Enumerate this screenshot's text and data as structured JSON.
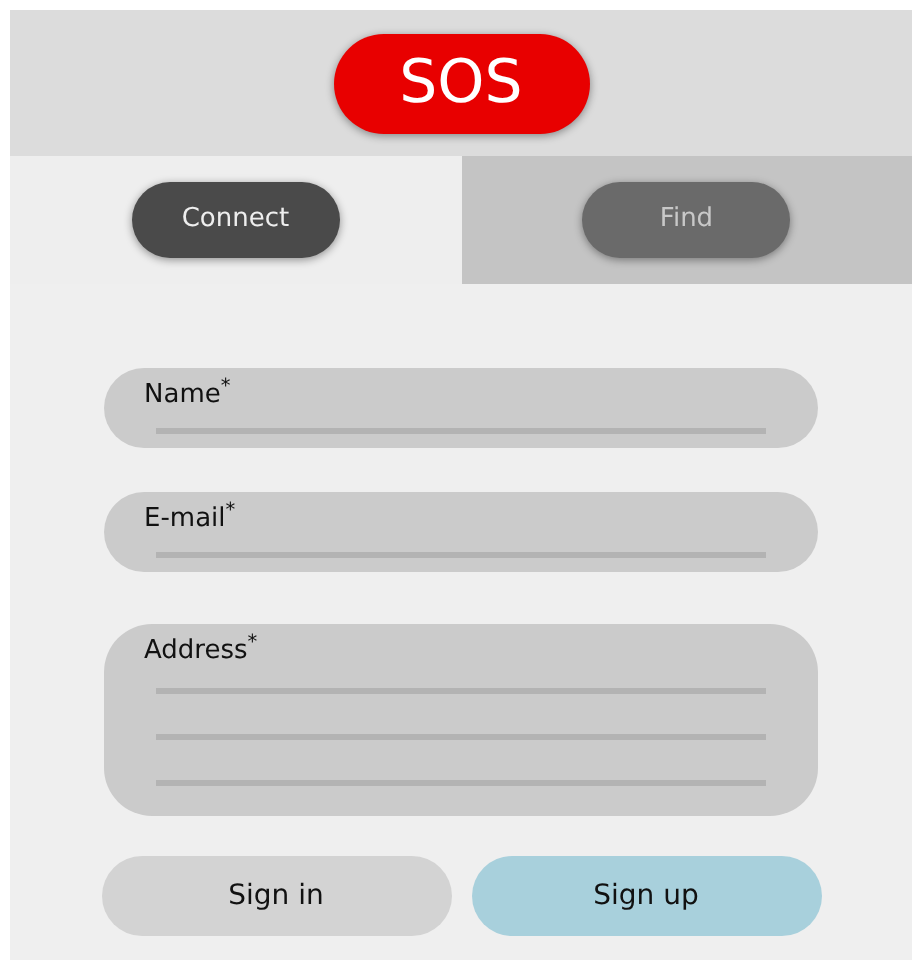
{
  "header": {
    "sos_button": "SOS"
  },
  "tabs": [
    {
      "label": "Connect",
      "selected": true
    },
    {
      "label": "Find",
      "selected": false
    }
  ],
  "form": {
    "fields": [
      {
        "label": "Name$^{*}$",
        "kind": "single"
      },
      {
        "label": "E-mail$^{*}$",
        "kind": "single"
      },
      {
        "label": "Address$^{*}$",
        "kind": "multiline"
      }
    ],
    "buttons": [
      {
        "label": "Sign in",
        "kind": "secondary"
      },
      {
        "label": "Sign up",
        "kind": "primary"
      }
    ]
  }
}
